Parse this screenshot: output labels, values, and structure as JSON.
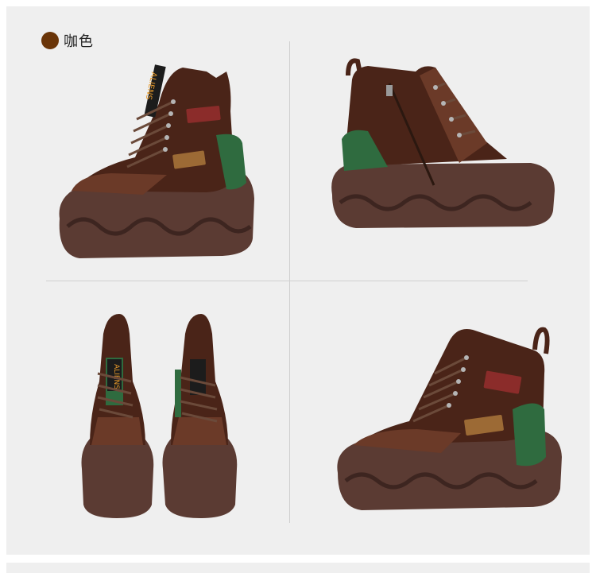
{
  "color_option": {
    "label": "咖色",
    "swatch_color": "#6a3508"
  },
  "views": [
    {
      "name": "side-view-left",
      "brand_tag": "ALIENS"
    },
    {
      "name": "side-view-inner"
    },
    {
      "name": "front-view-pair",
      "brand_tag": "ALIENS"
    },
    {
      "name": "side-view-right"
    }
  ],
  "colors": {
    "upper_brown": "#4a2418",
    "sole_brown": "#5b3b33",
    "accent_green": "#2f6b3f",
    "patch_red": "#8b2c2a",
    "patch_tan": "#9c6a35",
    "lace": "#6b4a3a"
  }
}
